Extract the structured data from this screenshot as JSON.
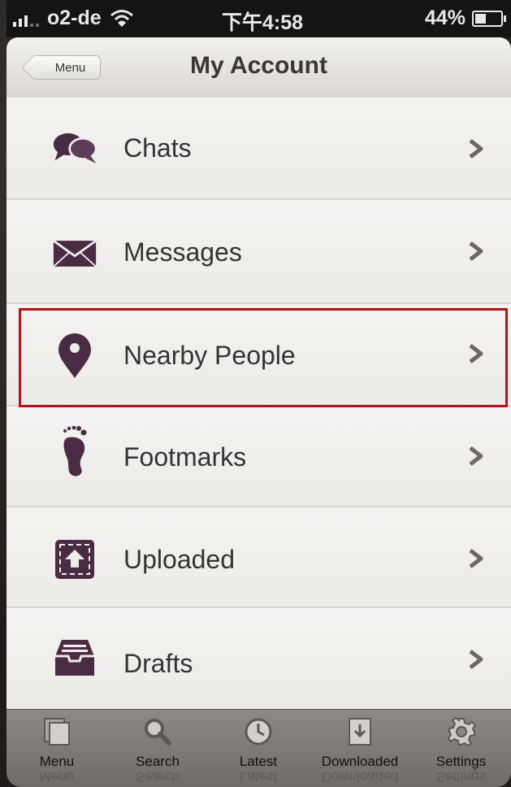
{
  "status_bar": {
    "carrier": "o2-de",
    "time": "下午4:58",
    "battery_percent": "44%",
    "battery_level": 0.44
  },
  "nav": {
    "back_label": "Menu",
    "title": "My Account"
  },
  "menu": {
    "items": [
      {
        "label": "Chats",
        "icon": "chat-bubbles-icon"
      },
      {
        "label": "Messages",
        "icon": "envelope-icon"
      },
      {
        "label": "Nearby People",
        "icon": "location-pin-icon"
      },
      {
        "label": "Footmarks",
        "icon": "footprint-icon"
      },
      {
        "label": "Uploaded",
        "icon": "upload-icon"
      },
      {
        "label": "Drafts",
        "icon": "inbox-tray-icon"
      }
    ]
  },
  "tabbar": {
    "tabs": [
      {
        "label": "Menu",
        "icon": "menu-pages-icon"
      },
      {
        "label": "Search",
        "icon": "magnifier-icon"
      },
      {
        "label": "Latest",
        "icon": "clock-icon"
      },
      {
        "label": "Downloaded",
        "icon": "download-icon"
      },
      {
        "label": "Settings",
        "icon": "gear-icon"
      }
    ]
  },
  "colors": {
    "icon_purple": "#4a2b44",
    "highlight_red": "#b3121b",
    "chevron_gray": "#6d6866"
  }
}
